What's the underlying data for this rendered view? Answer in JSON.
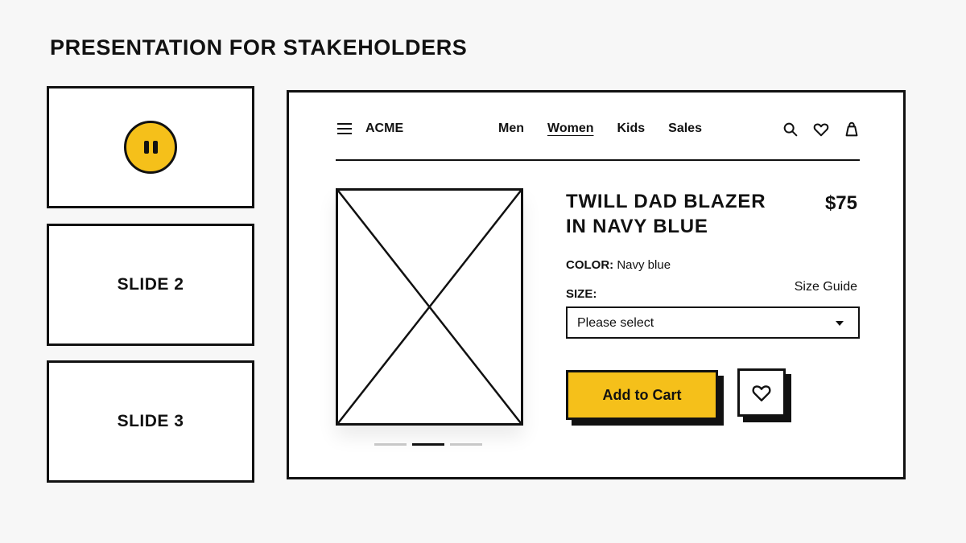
{
  "page": {
    "title": "PRESENTATION FOR STAKEHOLDERS"
  },
  "thumbnails": {
    "slide1": {
      "icon": "pause-icon"
    },
    "slide2": {
      "label": "SLIDE 2"
    },
    "slide3": {
      "label": "SLIDE 3"
    }
  },
  "nav": {
    "brand": "ACME",
    "links": [
      "Men",
      "Women",
      "Kids",
      "Sales"
    ],
    "active_link": "Women",
    "icons": [
      "search-icon",
      "heart-icon",
      "bag-icon"
    ]
  },
  "product": {
    "title_line1": "TWILL DAD BLAZER",
    "title_line2": "IN NAVY BLUE",
    "price": "$75",
    "color_label": "COLOR:",
    "color_value": "Navy blue",
    "size_label": "SIZE:",
    "size_guide": "Size Guide",
    "size_placeholder": "Please select",
    "add_to_cart": "Add to Cart",
    "carousel": {
      "count": 3,
      "active_index": 1
    }
  },
  "colors": {
    "accent": "#f5c01a",
    "ink": "#111111",
    "background": "#f7f7f7"
  }
}
